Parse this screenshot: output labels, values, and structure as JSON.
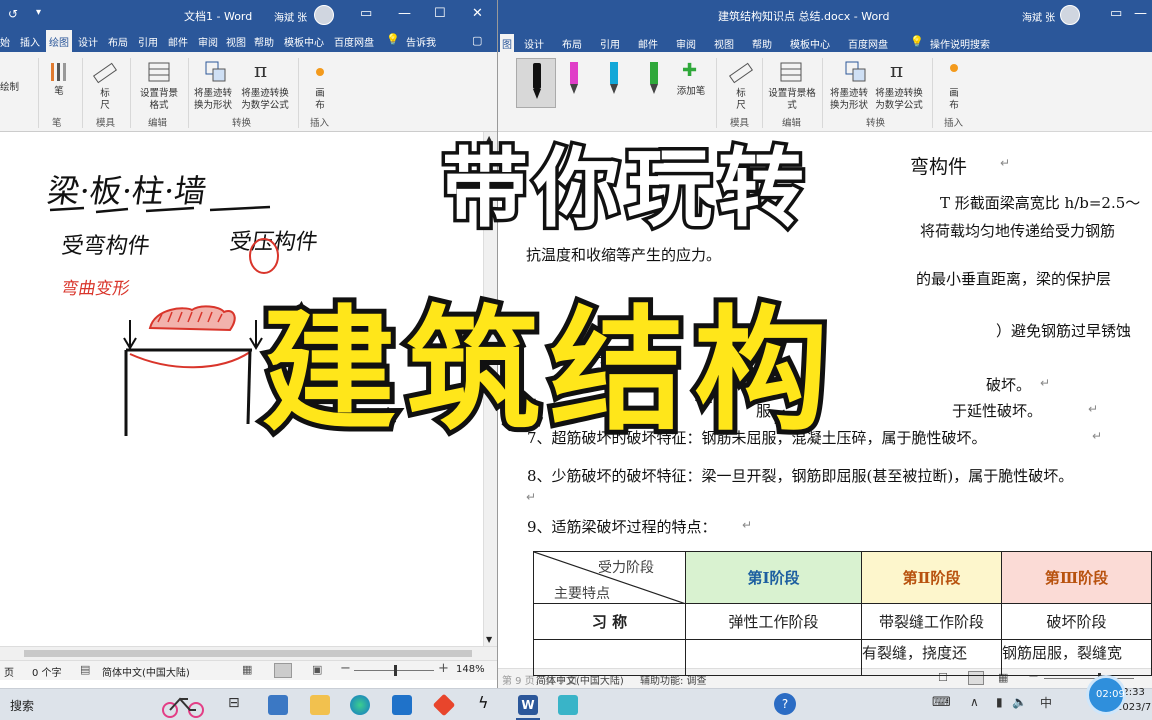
{
  "left_window": {
    "title": "文档1 - Word",
    "user": "海斌 张",
    "tabs": [
      "始",
      "插入",
      "绘图",
      "设计",
      "布局",
      "引用",
      "邮件",
      "审阅",
      "视图",
      "帮助",
      "模板中心",
      "百度网盘",
      "告诉我"
    ],
    "active_tab": "绘图",
    "ribbon": {
      "draw_label": "绘制",
      "pen_label": "笔",
      "ruler_label": "标尺",
      "background_label": "设置背景格式",
      "ink_to_shape": "将墨迹转换为形状",
      "ink_to_math": "将墨迹转换为数学公式",
      "canvas_label": "画布",
      "groups": [
        "笔",
        "模具",
        "编辑",
        "转换",
        "插入"
      ]
    },
    "handwriting": {
      "line1": "梁·板·柱·墙",
      "line2a": "受弯构件",
      "line2b": "受压构件",
      "line3": "弯曲变形"
    },
    "status": {
      "page": "页",
      "words": "0 个字",
      "language": "简体中文(中国大陆)",
      "zoom": "148%"
    }
  },
  "right_window": {
    "title": "建筑结构知识点 总结.docx - Word",
    "user": "海斌 张",
    "tabs": [
      "设计",
      "布局",
      "引用",
      "邮件",
      "审阅",
      "视图",
      "帮助",
      "模板中心",
      "百度网盘",
      "操作说明搜索"
    ],
    "ribbon": {
      "add_pen": "添加笔",
      "ruler_label": "标尺",
      "background_label": "设置背景格式",
      "ink_to_shape": "将墨迹转换为形状",
      "ink_to_math": "将墨迹转换为数学公式",
      "canvas_label": "画布",
      "groups": [
        "模具",
        "编辑",
        "转换",
        "插入"
      ]
    },
    "doc_lines": [
      "弯构件",
      "T 形截面梁高宽比  h/b=2.5～",
      "将荷载均匀地传递给受力钢筋",
      "抗温度和收缩等产生的应力。",
      "的最小垂直距离，梁的保护层",
      "）避免钢筋过早锈蚀",
      "钢筋",
      "破坏。",
      "服，",
      "于延性破坏。",
      "7、超筋破坏的破坏特征：钢筋未屈服，混凝土压碎，属于脆性破坏。",
      "8、少筋破坏的破坏特征：梁一旦开裂，钢筋即屈服(甚至被拉断)，属于脆性破坏。",
      "9、适筋梁破坏过程的特点："
    ],
    "table": {
      "corner_top": "受力阶段",
      "corner_bottom": "主要特点",
      "headers": [
        "第Ⅰ阶段",
        "第Ⅱ阶段",
        "第Ⅲ阶段"
      ],
      "row1": [
        "习    称",
        "弹性工作阶段",
        "带裂缝工作阶段",
        "破坏阶段"
      ],
      "row2_partial": [
        "",
        "",
        "有裂缝，挠度还",
        "钢筋屈服，裂缝宽"
      ]
    },
    "status": {
      "page": "第 9 页，共 9 页",
      "words": "3197 个字",
      "language": "简体中文(中国大陆)",
      "accessibility": "辅助功能: 调查"
    }
  },
  "overlay": {
    "title_line1": "带你玩转",
    "title_line2": "建筑结构"
  },
  "taskbar": {
    "search": "搜索",
    "clock_time": "22:33",
    "clock_date": "2023/7",
    "badge_time": "02:09"
  },
  "colors": {
    "word_blue": "#2b579a",
    "title_yellow": "#ffe61a",
    "ink_red": "#d9352b",
    "header_green": "#d9f2d0",
    "header_yellow": "#fdf6cc",
    "header_pink": "#fbdbd6"
  }
}
